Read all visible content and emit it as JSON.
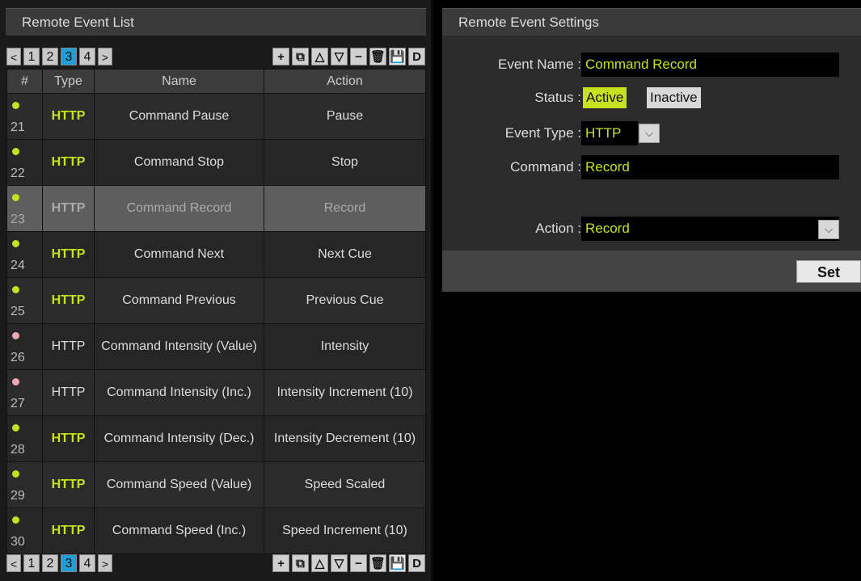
{
  "list_panel": {
    "title": "Remote Event List",
    "pager": {
      "prev": "<",
      "pages": [
        "1",
        "2",
        "3",
        "4"
      ],
      "active_page": "3",
      "next": ">"
    },
    "tools": [
      "+",
      "⧉",
      "△",
      "▽",
      "−",
      "🗑",
      "💾",
      "D"
    ],
    "columns": {
      "num": "#",
      "type": "Type",
      "name": "Name",
      "action": "Action"
    },
    "rows": [
      {
        "num": "21",
        "type": "HTTP",
        "active": true,
        "name": "Command Pause",
        "action": "Pause"
      },
      {
        "num": "22",
        "type": "HTTP",
        "active": true,
        "name": "Command Stop",
        "action": "Stop"
      },
      {
        "num": "23",
        "type": "HTTP",
        "active": true,
        "name": "Command Record",
        "action": "Record",
        "selected": true
      },
      {
        "num": "24",
        "type": "HTTP",
        "active": true,
        "name": "Command Next",
        "action": "Next Cue"
      },
      {
        "num": "25",
        "type": "HTTP",
        "active": true,
        "name": "Command Previous",
        "action": "Previous Cue"
      },
      {
        "num": "26",
        "type": "HTTP",
        "active": false,
        "name": "Command Intensity (Value)",
        "action": "Intensity"
      },
      {
        "num": "27",
        "type": "HTTP",
        "active": false,
        "name": "Command Intensity (Inc.)",
        "action": "Intensity Increment (10)"
      },
      {
        "num": "28",
        "type": "HTTP",
        "active": true,
        "name": "Command Intensity (Dec.)",
        "action": "Intensity Decrement (10)"
      },
      {
        "num": "29",
        "type": "HTTP",
        "active": true,
        "name": "Command Speed (Value)",
        "action": "Speed Scaled"
      },
      {
        "num": "30",
        "type": "HTTP",
        "active": true,
        "name": "Command Speed (Inc.)",
        "action": "Speed Increment (10)"
      }
    ]
  },
  "settings_panel": {
    "title": "Remote Event Settings",
    "event_name_label": "Event Name :",
    "event_name_value": "Command Record",
    "status_label": "Status :",
    "status_active": "Active",
    "status_inactive": "Inactive",
    "event_type_label": "Event Type :",
    "event_type_value": "HTTP",
    "command_label": "Command :",
    "command_value": "Record",
    "action_label": "Action :",
    "action_value": "Record",
    "set_label": "Set"
  },
  "colors": {
    "accent_green": "#c6e21e",
    "active_page_blue": "#1e9fd6",
    "inactive_dot": "#f2a7b3"
  }
}
